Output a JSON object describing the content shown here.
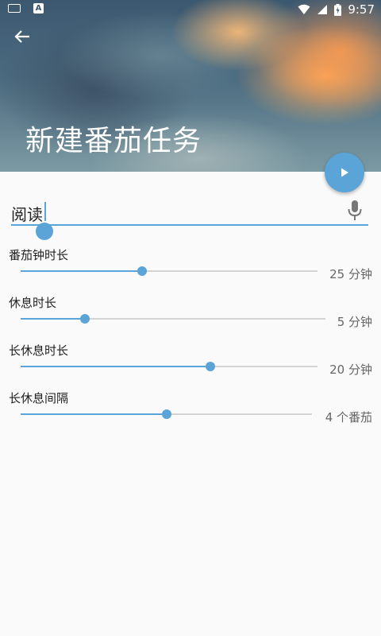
{
  "statusbar": {
    "time": "9:57"
  },
  "header": {
    "title": "新建番茄任务"
  },
  "task": {
    "value": "阅读"
  },
  "settings": [
    {
      "label": "番茄钟时长",
      "value_text": "25 分钟",
      "value": 25,
      "fraction": 0.41
    },
    {
      "label": "休息时长",
      "value_text": "5 分钟",
      "value": 5,
      "fraction": 0.21
    },
    {
      "label": "长休息时长",
      "value_text": "20 分钟",
      "value": 20,
      "fraction": 0.64
    },
    {
      "label": "长休息间隔",
      "value_text": "4 个番茄",
      "value": 4,
      "fraction": 0.5
    }
  ],
  "colors": {
    "accent": "#5aa4d8",
    "background": "#fafafa"
  },
  "icons": [
    "keyboard-icon",
    "a-notification-icon",
    "wifi-icon",
    "signal-icon",
    "battery-icon",
    "back-arrow-icon",
    "play-icon",
    "microphone-icon"
  ]
}
